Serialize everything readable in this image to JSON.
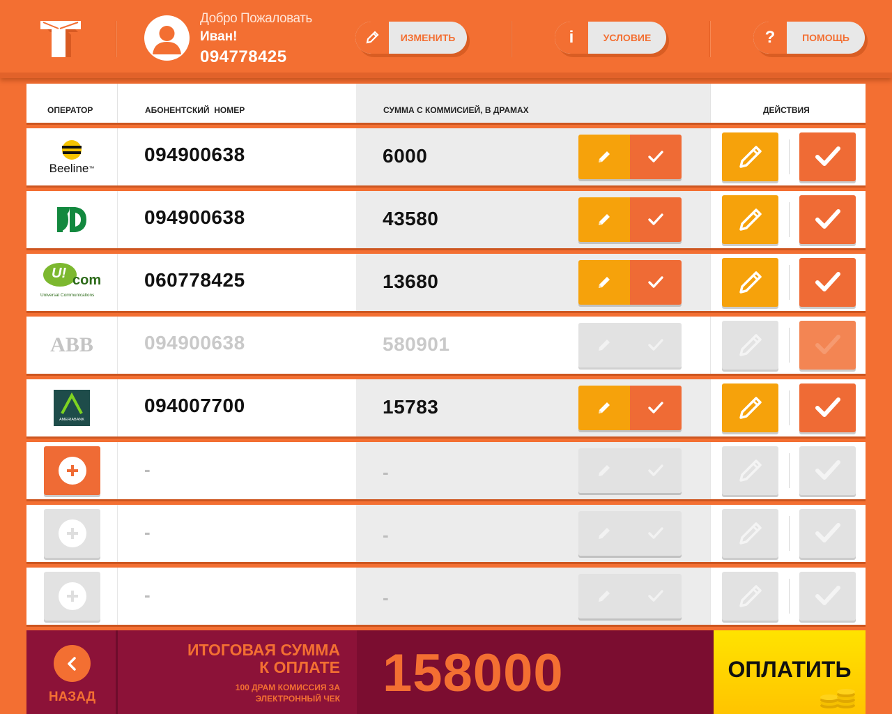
{
  "header": {
    "welcome": "Добро Пожаловать",
    "user_name": "Иван!",
    "user_phone": "094778425",
    "buttons": {
      "edit_label": "ИЗМЕНИТЬ",
      "condition_label": "УСЛОВИЕ",
      "help_label": "ПОМОЩЬ"
    }
  },
  "table": {
    "columns": {
      "operator": "ОПЕРАТОР",
      "subscriber": "АБОНЕНТСКИЙ  НОМЕР",
      "amount": "СУММА С КОММИСИЕЙ, В ДРАМАХ",
      "actions": "ДЕЙСТВИЯ"
    },
    "rows": [
      {
        "operator": "Beeline",
        "number": "094900638",
        "amount": "6000",
        "state": "active"
      },
      {
        "operator": "VivaCell",
        "number": "094900638",
        "amount": "43580",
        "state": "active"
      },
      {
        "operator": "Ucom",
        "number": "060778425",
        "amount": "13680",
        "state": "active"
      },
      {
        "operator": "ABB",
        "number": "094900638",
        "amount": "580901",
        "state": "disabled"
      },
      {
        "operator": "Ameriabank",
        "number": "094007700",
        "amount": "15783",
        "state": "active"
      },
      {
        "operator": "",
        "number": "-",
        "amount": "-",
        "state": "add-active"
      },
      {
        "operator": "",
        "number": "-",
        "amount": "-",
        "state": "add-disabled"
      },
      {
        "operator": "",
        "number": "-",
        "amount": "-",
        "state": "add-disabled"
      }
    ],
    "logo_text": {
      "beeline": "Beeline",
      "beeline_tm": "™",
      "ucom_u": "U!",
      "ucom_com": "com",
      "ucom_sub": "Universal Communications",
      "abb": "ABB",
      "ameria": "AMERIABANK"
    }
  },
  "footer": {
    "back_label": "НАЗАД",
    "total_label_line1": "ИТОГОВАЯ СУММА",
    "total_label_line2": "К ОПЛАТЕ",
    "commission_note_line1": "100 ДРАМ КОМИССИЯ ЗА",
    "commission_note_line2": "ЭЛЕКТРОННЫЙ ЧЕК",
    "total_value": "158000",
    "pay_label": "ОПЛАТИТЬ"
  },
  "colors": {
    "brand_orange": "#f36f32",
    "edit_yellow": "#f6a20b",
    "footer_maroon": "#8c1238",
    "pay_yellow": "#ffd400"
  }
}
